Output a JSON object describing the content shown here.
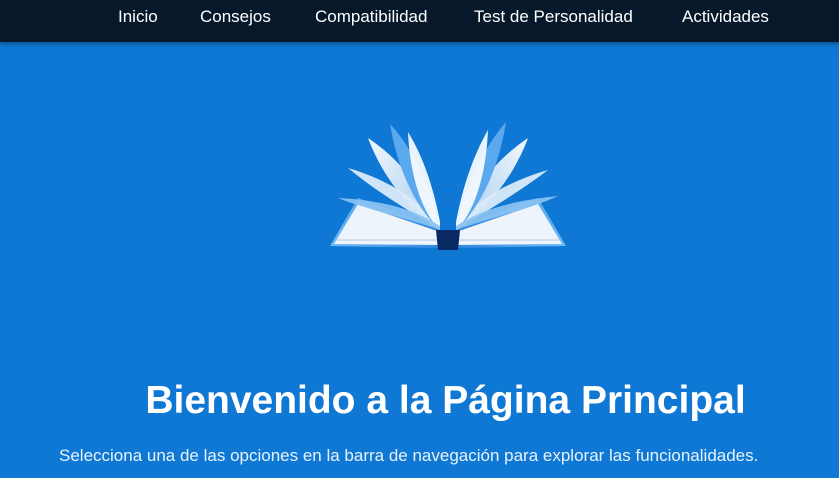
{
  "nav": {
    "items": [
      {
        "label": "Inicio"
      },
      {
        "label": "Consejos"
      },
      {
        "label": "Compatibilidad"
      },
      {
        "label": "Test de Personalidad"
      },
      {
        "label": "Actividades"
      }
    ]
  },
  "hero": {
    "image_icon": "open-book-icon",
    "title": "Bienvenido a la Página Principal",
    "subtitle": "Selecciona una de las opciones en la barra de navegación para explorar las funcionalidades."
  },
  "colors": {
    "background": "#0f78d4",
    "navbar": "#07182b",
    "text": "#ffffff"
  }
}
